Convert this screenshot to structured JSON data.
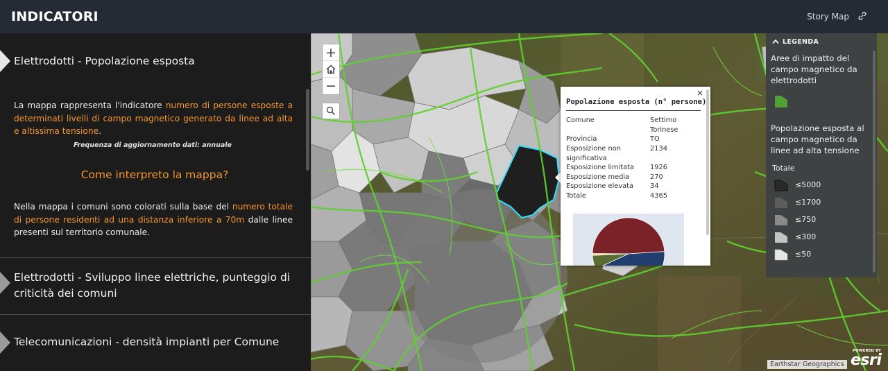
{
  "header": {
    "title": "INDICATORI",
    "story_map_label": "Story Map",
    "link_icon": "link-icon"
  },
  "sidebar": {
    "active_section": {
      "title": "Elettrodotti - Popolazione esposta",
      "intro_prefix": "La mappa rappresenta l'indicatore ",
      "intro_highlight": "numero di persone esposte a determinati livelli di campo magnetico generato da linee ad alta e altissima tensione",
      "intro_suffix": ".",
      "frequency_note": "Frequenza di aggiornamento dati: annuale",
      "subheading": "Come interpreto la mappa?",
      "body_prefix": "Nella mappa i comuni sono colorati sulla base del ",
      "body_highlight": "numero totale di persone residenti ad una distanza inferiore a 70m",
      "body_suffix": " dalle linee presenti sul territorio comunale."
    },
    "collapsed_sections": [
      {
        "title": "Elettrodotti - Sviluppo linee elettriche, punteggio di criticità dei comuni"
      },
      {
        "title": "Telecomunicazioni - densità impianti per Comune"
      }
    ],
    "highlight_color": "#f5962f"
  },
  "map": {
    "zoom_in_label": "+",
    "zoom_out_label": "−",
    "home_icon": "home-icon",
    "search_icon": "search-icon",
    "line_color": "#5fd02f",
    "selected_outline_color": "#33e0ff"
  },
  "popup": {
    "title": "Popolazione esposta (n° persone)",
    "close_label": "×",
    "fields": [
      {
        "key": "Comune",
        "value": "Settimo Torinese"
      },
      {
        "key": "Provincia",
        "value": "TO"
      },
      {
        "key": "Esposizione non significativa",
        "value": "2134"
      },
      {
        "key": "Esposizione limitata",
        "value": "1926"
      },
      {
        "key": "Esposizione media",
        "value": "270"
      },
      {
        "key": "Esposizione elevata",
        "value": "34"
      },
      {
        "key": "Totale",
        "value": "4365"
      }
    ],
    "chart_data": {
      "type": "pie",
      "slices": [
        {
          "label": "Esposizione non significativa",
          "value": 2134,
          "color": "#7a2228"
        },
        {
          "label": "Esposizione limitata",
          "value": 1926,
          "color": "#213f6e"
        },
        {
          "label": "Esposizione media",
          "value": 270,
          "color": "#5a6b34"
        },
        {
          "label": "Esposizione elevata",
          "value": 34,
          "color": "#e8d77a"
        }
      ]
    }
  },
  "legend": {
    "header": "LEGENDA",
    "layer1_title": "Aree di impatto del campo magnetico da elettrodotti",
    "layer1_color": "#4fa035",
    "layer2_title": "Popolazione esposta al campo magnetico da linee ad alta tensione",
    "field_label": "Totale",
    "classes": [
      {
        "label": "≤5000",
        "color": "#2a2a2a"
      },
      {
        "label": "≤1700",
        "color": "#5c5c5c"
      },
      {
        "label": "≤750",
        "color": "#8a8a8a"
      },
      {
        "label": "≤300",
        "color": "#c4c4c4"
      },
      {
        "label": "≤50",
        "color": "#e6e6e6"
      }
    ]
  },
  "attribution": {
    "text": "Earthstar Geographics",
    "powered_by": "POWERED BY",
    "brand": "esri"
  }
}
